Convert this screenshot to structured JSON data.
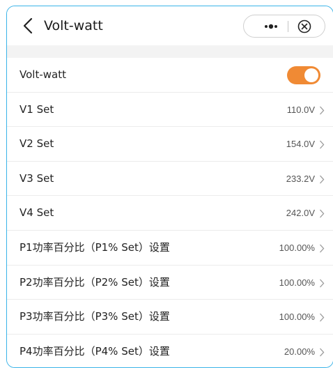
{
  "header": {
    "title": "Volt-watt",
    "back_icon": "chevron-left-icon",
    "more_icon": "more-dots-icon",
    "close_icon": "close-circle-icon"
  },
  "toggle_row": {
    "label": "Volt-watt",
    "enabled": true,
    "color": "#f08a34"
  },
  "rows": [
    {
      "label": "V1 Set",
      "value": "110.0V"
    },
    {
      "label": "V2 Set",
      "value": "154.0V"
    },
    {
      "label": "V3 Set",
      "value": "233.2V"
    },
    {
      "label": "V4 Set",
      "value": "242.0V"
    },
    {
      "label": "P1功率百分比（P1% Set）设置",
      "value": "100.00%"
    },
    {
      "label": "P2功率百分比（P2% Set）设置",
      "value": "100.00%"
    },
    {
      "label": "P3功率百分比（P3% Set）设置",
      "value": "100.00%"
    },
    {
      "label": "P4功率百分比（P4% Set）设置",
      "value": "20.00%"
    }
  ],
  "colors": {
    "frame_border": "#39b3e8",
    "separator_band": "#f3f3f3"
  }
}
